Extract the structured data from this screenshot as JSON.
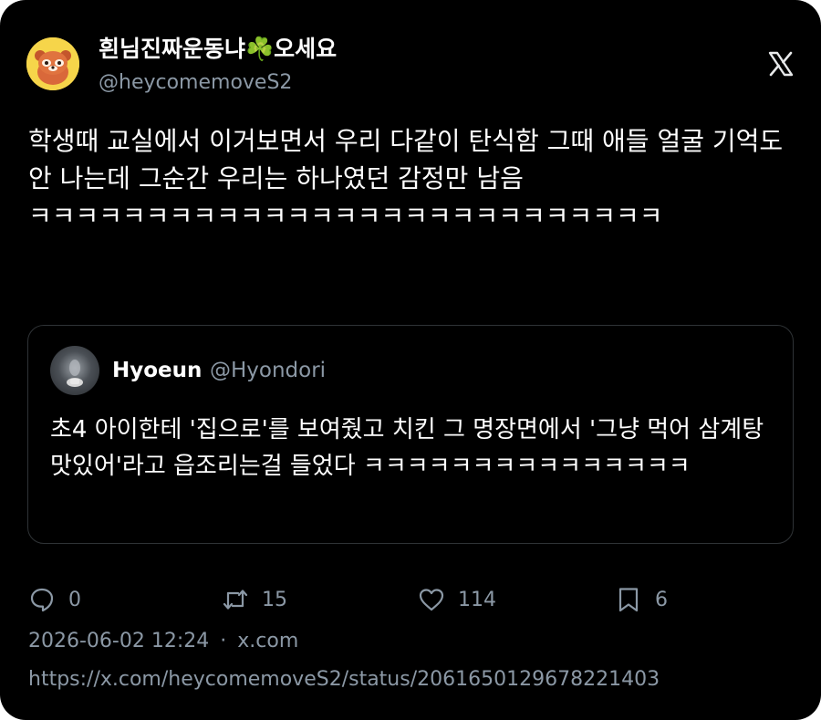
{
  "author": {
    "display_name": "흰님진짜운동냐☘️오세요",
    "handle": "@heycomemoveS2",
    "avatar_icon": "red-panda-avatar"
  },
  "platform_icon": "x-logo-icon",
  "tweet": {
    "text": "학생때 교실에서 이거보면서 우리 다같이 탄식함 그때 애들 얼굴 기억도 안 나는데 그순간 우리는 하나였던 감정만 남음 ㅋㅋㅋㅋㅋㅋㅋㅋㅋㅋㅋㅋㅋㅋㅋㅋㅋㅋㅋㅋㅋㅋㅋㅋㅋㅋㅋ"
  },
  "quoted_tweet": {
    "display_name": "Hyoeun",
    "handle": "@Hyondori",
    "text": "초4 아이한테 '집으로'를 보여줬고 치킨 그 명장면에서 '그냥 먹어 삼계탕 맛있어'라고 읍조리는걸 들었다 ㅋㅋㅋㅋㅋㅋㅋㅋㅋㅋㅋㅋㅋㅋㅋ"
  },
  "actions": {
    "reply_count": "0",
    "retweet_count": "15",
    "like_count": "114",
    "bookmark_count": "6"
  },
  "meta": {
    "timestamp": "2026-06-02 12:24",
    "separator": "·",
    "source": "x.com"
  },
  "url": "https://x.com/heycomemoveS2/status/2061650129678221403",
  "colors": {
    "background": "#000000",
    "text": "#ffffff",
    "muted": "#8b98a5",
    "border": "#2f3336"
  }
}
